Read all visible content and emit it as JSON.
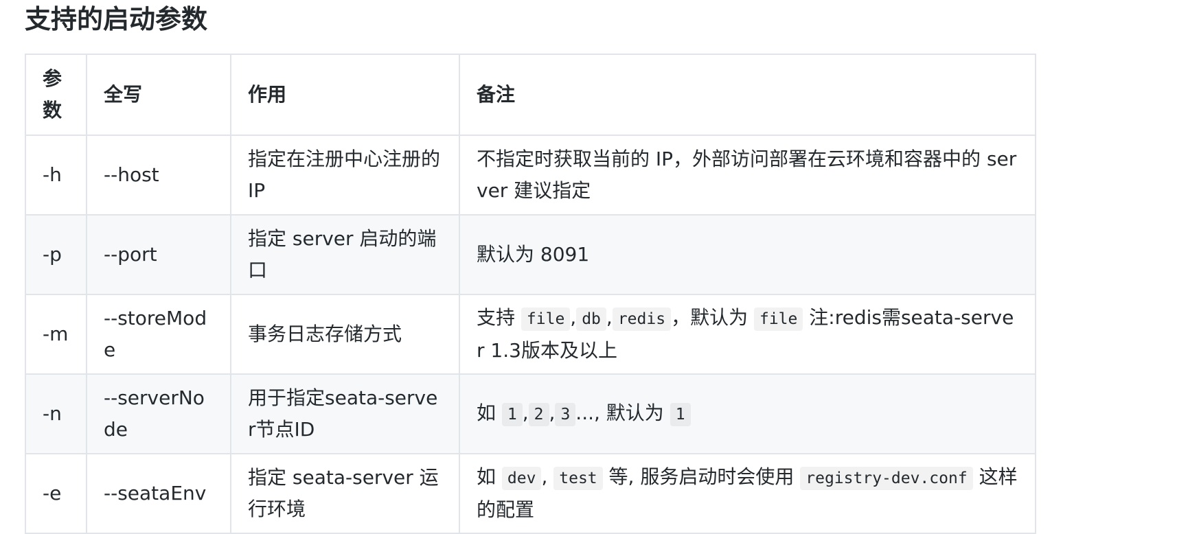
{
  "heading": "支持的启动参数",
  "table": {
    "headers": [
      "参数",
      "全写",
      "作用",
      "备注"
    ],
    "rows": [
      {
        "flag": "-h",
        "full": "--host",
        "purpose": "指定在注册中心注册的 IP",
        "note": [
          {
            "t": "text",
            "v": "不指定时获取当前的 IP，外部访问部署在云环境和容器中的 server 建议指定"
          }
        ]
      },
      {
        "flag": "-p",
        "full": "--port",
        "purpose": "指定 server 启动的端口",
        "note": [
          {
            "t": "text",
            "v": "默认为 8091"
          }
        ]
      },
      {
        "flag": "-m",
        "full": "--storeMode",
        "purpose": "事务日志存储方式",
        "note": [
          {
            "t": "text",
            "v": "支持 "
          },
          {
            "t": "code",
            "v": "file"
          },
          {
            "t": "text",
            "v": ","
          },
          {
            "t": "code",
            "v": "db"
          },
          {
            "t": "text",
            "v": ","
          },
          {
            "t": "code",
            "v": "redis"
          },
          {
            "t": "text",
            "v": "，默认为 "
          },
          {
            "t": "code",
            "v": "file"
          },
          {
            "t": "text",
            "v": " 注:redis需seata-server 1.3版本及以上"
          }
        ]
      },
      {
        "flag": "-n",
        "full": "--serverNode",
        "purpose": "用于指定seata-server节点ID",
        "note": [
          {
            "t": "text",
            "v": "如 "
          },
          {
            "t": "code",
            "v": "1"
          },
          {
            "t": "text",
            "v": ","
          },
          {
            "t": "code",
            "v": "2"
          },
          {
            "t": "text",
            "v": ","
          },
          {
            "t": "code",
            "v": "3"
          },
          {
            "t": "text",
            "v": "..., 默认为 "
          },
          {
            "t": "code",
            "v": "1"
          }
        ]
      },
      {
        "flag": "-e",
        "full": "--seataEnv",
        "purpose": "指定 seata-server 运行环境",
        "note": [
          {
            "t": "text",
            "v": "如 "
          },
          {
            "t": "code",
            "v": "dev"
          },
          {
            "t": "text",
            "v": ", "
          },
          {
            "t": "code",
            "v": "test"
          },
          {
            "t": "text",
            "v": " 等, 服务启动时会使用 "
          },
          {
            "t": "code",
            "v": "registry-dev.conf"
          },
          {
            "t": "text",
            "v": " 这样的配置"
          }
        ]
      }
    ]
  }
}
